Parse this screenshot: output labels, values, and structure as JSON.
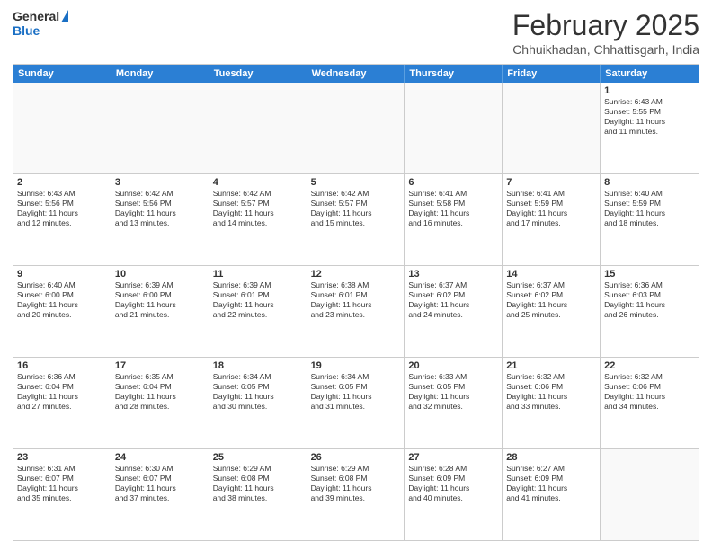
{
  "logo": {
    "general": "General",
    "blue": "Blue"
  },
  "title": "February 2025",
  "location": "Chhuikhadan, Chhattisgarh, India",
  "weekdays": [
    "Sunday",
    "Monday",
    "Tuesday",
    "Wednesday",
    "Thursday",
    "Friday",
    "Saturday"
  ],
  "rows": [
    [
      {
        "day": "",
        "text": ""
      },
      {
        "day": "",
        "text": ""
      },
      {
        "day": "",
        "text": ""
      },
      {
        "day": "",
        "text": ""
      },
      {
        "day": "",
        "text": ""
      },
      {
        "day": "",
        "text": ""
      },
      {
        "day": "1",
        "text": "Sunrise: 6:43 AM\nSunset: 5:55 PM\nDaylight: 11 hours\nand 11 minutes."
      }
    ],
    [
      {
        "day": "2",
        "text": "Sunrise: 6:43 AM\nSunset: 5:56 PM\nDaylight: 11 hours\nand 12 minutes."
      },
      {
        "day": "3",
        "text": "Sunrise: 6:42 AM\nSunset: 5:56 PM\nDaylight: 11 hours\nand 13 minutes."
      },
      {
        "day": "4",
        "text": "Sunrise: 6:42 AM\nSunset: 5:57 PM\nDaylight: 11 hours\nand 14 minutes."
      },
      {
        "day": "5",
        "text": "Sunrise: 6:42 AM\nSunset: 5:57 PM\nDaylight: 11 hours\nand 15 minutes."
      },
      {
        "day": "6",
        "text": "Sunrise: 6:41 AM\nSunset: 5:58 PM\nDaylight: 11 hours\nand 16 minutes."
      },
      {
        "day": "7",
        "text": "Sunrise: 6:41 AM\nSunset: 5:59 PM\nDaylight: 11 hours\nand 17 minutes."
      },
      {
        "day": "8",
        "text": "Sunrise: 6:40 AM\nSunset: 5:59 PM\nDaylight: 11 hours\nand 18 minutes."
      }
    ],
    [
      {
        "day": "9",
        "text": "Sunrise: 6:40 AM\nSunset: 6:00 PM\nDaylight: 11 hours\nand 20 minutes."
      },
      {
        "day": "10",
        "text": "Sunrise: 6:39 AM\nSunset: 6:00 PM\nDaylight: 11 hours\nand 21 minutes."
      },
      {
        "day": "11",
        "text": "Sunrise: 6:39 AM\nSunset: 6:01 PM\nDaylight: 11 hours\nand 22 minutes."
      },
      {
        "day": "12",
        "text": "Sunrise: 6:38 AM\nSunset: 6:01 PM\nDaylight: 11 hours\nand 23 minutes."
      },
      {
        "day": "13",
        "text": "Sunrise: 6:37 AM\nSunset: 6:02 PM\nDaylight: 11 hours\nand 24 minutes."
      },
      {
        "day": "14",
        "text": "Sunrise: 6:37 AM\nSunset: 6:02 PM\nDaylight: 11 hours\nand 25 minutes."
      },
      {
        "day": "15",
        "text": "Sunrise: 6:36 AM\nSunset: 6:03 PM\nDaylight: 11 hours\nand 26 minutes."
      }
    ],
    [
      {
        "day": "16",
        "text": "Sunrise: 6:36 AM\nSunset: 6:04 PM\nDaylight: 11 hours\nand 27 minutes."
      },
      {
        "day": "17",
        "text": "Sunrise: 6:35 AM\nSunset: 6:04 PM\nDaylight: 11 hours\nand 28 minutes."
      },
      {
        "day": "18",
        "text": "Sunrise: 6:34 AM\nSunset: 6:05 PM\nDaylight: 11 hours\nand 30 minutes."
      },
      {
        "day": "19",
        "text": "Sunrise: 6:34 AM\nSunset: 6:05 PM\nDaylight: 11 hours\nand 31 minutes."
      },
      {
        "day": "20",
        "text": "Sunrise: 6:33 AM\nSunset: 6:05 PM\nDaylight: 11 hours\nand 32 minutes."
      },
      {
        "day": "21",
        "text": "Sunrise: 6:32 AM\nSunset: 6:06 PM\nDaylight: 11 hours\nand 33 minutes."
      },
      {
        "day": "22",
        "text": "Sunrise: 6:32 AM\nSunset: 6:06 PM\nDaylight: 11 hours\nand 34 minutes."
      }
    ],
    [
      {
        "day": "23",
        "text": "Sunrise: 6:31 AM\nSunset: 6:07 PM\nDaylight: 11 hours\nand 35 minutes."
      },
      {
        "day": "24",
        "text": "Sunrise: 6:30 AM\nSunset: 6:07 PM\nDaylight: 11 hours\nand 37 minutes."
      },
      {
        "day": "25",
        "text": "Sunrise: 6:29 AM\nSunset: 6:08 PM\nDaylight: 11 hours\nand 38 minutes."
      },
      {
        "day": "26",
        "text": "Sunrise: 6:29 AM\nSunset: 6:08 PM\nDaylight: 11 hours\nand 39 minutes."
      },
      {
        "day": "27",
        "text": "Sunrise: 6:28 AM\nSunset: 6:09 PM\nDaylight: 11 hours\nand 40 minutes."
      },
      {
        "day": "28",
        "text": "Sunrise: 6:27 AM\nSunset: 6:09 PM\nDaylight: 11 hours\nand 41 minutes."
      },
      {
        "day": "",
        "text": ""
      }
    ]
  ]
}
